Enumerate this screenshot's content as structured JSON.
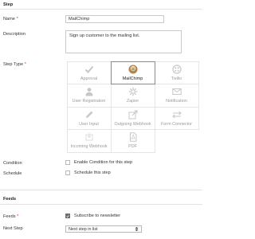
{
  "step_section": {
    "title": "Step"
  },
  "name_field": {
    "label": "Name",
    "required": "*",
    "value": "MailChimp"
  },
  "description_field": {
    "label": "Description",
    "value": "Sign up customer to the mailing list."
  },
  "step_type": {
    "label": "Step Type",
    "required": "*",
    "tiles": [
      {
        "label": "Approval",
        "icon": "checkmark-icon",
        "selected": false
      },
      {
        "label": "MailChimp",
        "icon": "mailchimp-icon",
        "selected": true
      },
      {
        "label": "Twilio",
        "icon": "twilio-icon",
        "selected": false
      },
      {
        "label": "User Registration",
        "icon": "user-icon",
        "selected": false
      },
      {
        "label": "Zapier",
        "icon": "zapier-icon",
        "selected": false
      },
      {
        "label": "Notification",
        "icon": "envelope-icon",
        "selected": false
      },
      {
        "label": "User Input",
        "icon": "pencil-icon",
        "selected": false
      },
      {
        "label": "Outgoing Webhook",
        "icon": "external-link-icon",
        "selected": false
      },
      {
        "label": "Form Connector",
        "icon": "connector-icon",
        "selected": false
      },
      {
        "label": "Incoming Webhook",
        "icon": "webhook-icon",
        "selected": false
      },
      {
        "label": "PDF",
        "icon": "pdf-icon",
        "selected": false
      }
    ]
  },
  "condition": {
    "label": "Condition",
    "checkbox_label": "Enable Condition for this step",
    "checked": false
  },
  "schedule": {
    "label": "Schedule",
    "checkbox_label": "Schedule this step",
    "checked": false
  },
  "feeds_section": {
    "title": "Feeds"
  },
  "feeds": {
    "label": "Feeds",
    "required": "*",
    "checkbox_label": "Subscribe to newsletter",
    "checked": true
  },
  "next_step": {
    "label": "Next Step",
    "value": "Next step in list"
  },
  "colors": {
    "required": "#d9302c",
    "selected_border": "#8a8a8a",
    "muted_icon": "#c7c7c7"
  }
}
